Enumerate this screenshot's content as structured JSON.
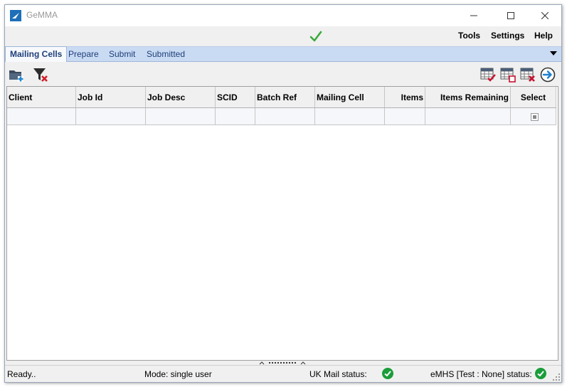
{
  "window": {
    "title": "GeMMA",
    "buttons": {
      "minimize": "minimize",
      "maximize": "maximize",
      "close": "close"
    }
  },
  "menu": {
    "status_icon": "check-icon",
    "items": [
      "Tools",
      "Settings",
      "Help"
    ]
  },
  "tabs": {
    "items": [
      "Mailing Cells",
      "Prepare",
      "Submit",
      "Submitted"
    ],
    "active": "Mailing Cells"
  },
  "toolbar": {
    "left_icons": [
      "open-folder-add-icon",
      "clear-filter-icon"
    ],
    "right_icons": [
      "select-all-rows-icon",
      "deselect-rows-icon",
      "delete-rows-icon",
      "go-forward-icon"
    ]
  },
  "grid": {
    "columns": [
      "Client",
      "Job Id",
      "Job Desc",
      "SCID",
      "Batch Ref",
      "Mailing Cell",
      "Items",
      "Items Remaining",
      "Select"
    ],
    "rows": []
  },
  "status": {
    "ready": "Ready..",
    "mode": "Mode: single user",
    "ukmail": "UK Mail status:",
    "emhs": "eMHS [Test : None] status:"
  },
  "colors": {
    "accent": "#1f3f7a",
    "tab_bar": "#c9daf3",
    "ok_green": "#1a9d3a"
  }
}
